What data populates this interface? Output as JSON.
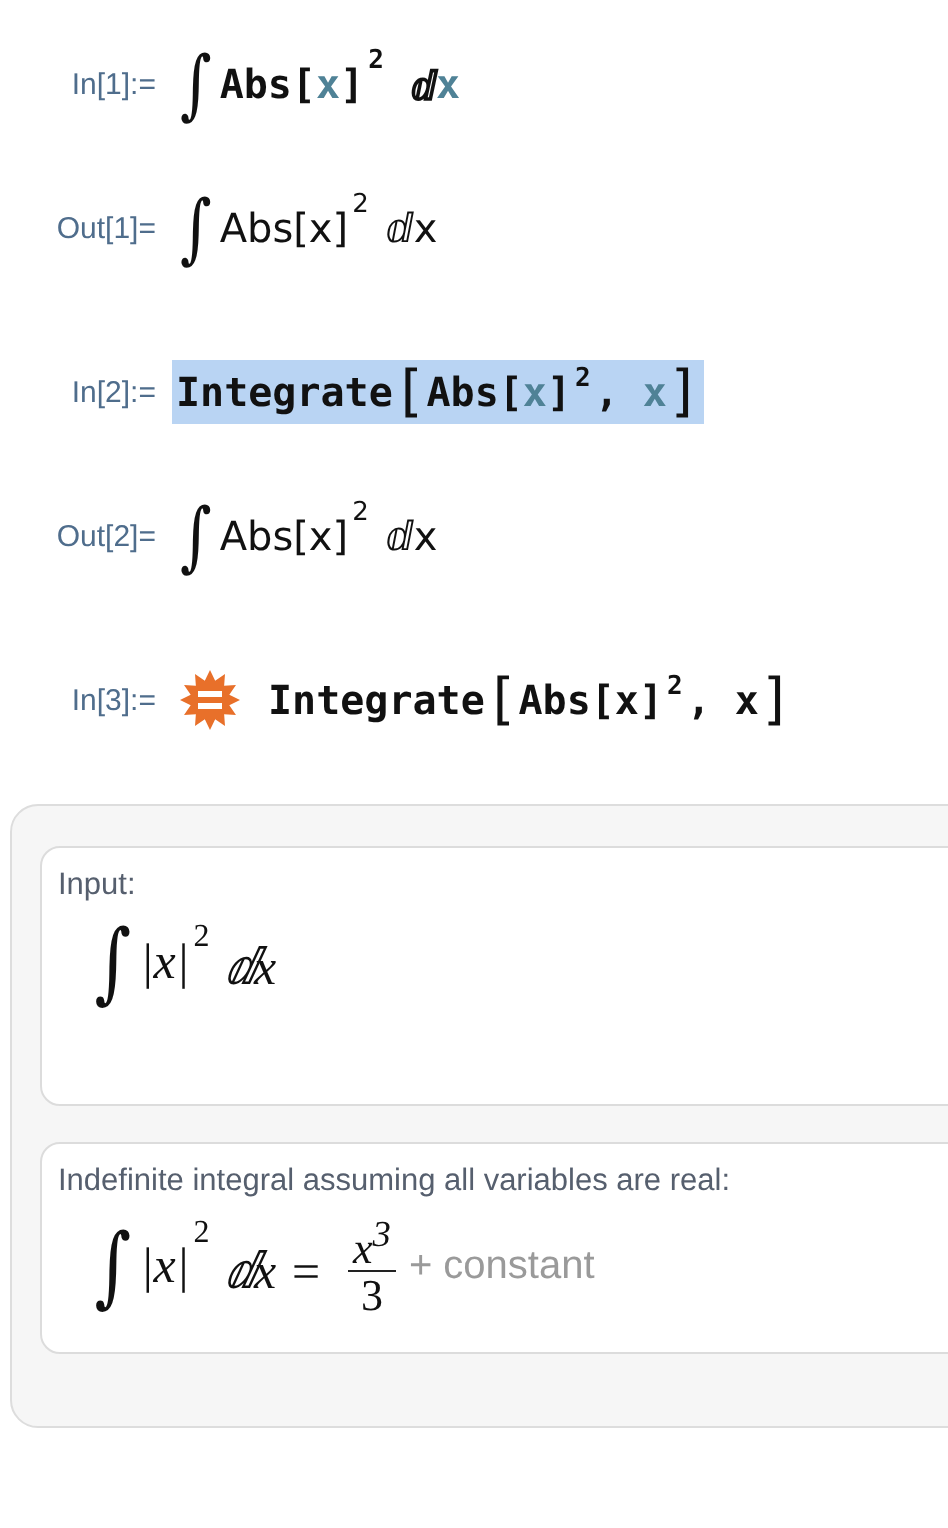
{
  "cells": [
    {
      "label": "In[1]:=",
      "kind": "input",
      "selected": false,
      "tokens": [
        {
          "kind": "integral",
          "text": "∫"
        },
        {
          "kind": "plain",
          "text": "Abs["
        },
        {
          "kind": "var",
          "text": "x"
        },
        {
          "kind": "plain",
          "text": "]"
        },
        {
          "kind": "sup",
          "text": "2"
        },
        {
          "kind": "plain",
          "text": " ⅆ"
        },
        {
          "kind": "var",
          "text": "x"
        }
      ]
    },
    {
      "label": "Out[1]=",
      "kind": "output",
      "selected": false,
      "tokens": [
        {
          "kind": "integral",
          "text": "∫"
        },
        {
          "kind": "plain",
          "text": "Abs[x]"
        },
        {
          "kind": "sup",
          "text": "2"
        },
        {
          "kind": "plain",
          "text": " ⅆx"
        }
      ]
    },
    {
      "label": "In[2]:=",
      "kind": "input",
      "selected": true,
      "tokens": [
        {
          "kind": "plain",
          "text": "Integrate"
        },
        {
          "kind": "bracket",
          "text": "["
        },
        {
          "kind": "plain",
          "text": "Abs["
        },
        {
          "kind": "var",
          "text": "x"
        },
        {
          "kind": "plain",
          "text": "]"
        },
        {
          "kind": "sup",
          "text": "2"
        },
        {
          "kind": "plain",
          "text": ", "
        },
        {
          "kind": "var",
          "text": "x"
        },
        {
          "kind": "bracket",
          "text": "]"
        }
      ]
    },
    {
      "label": "Out[2]=",
      "kind": "output",
      "selected": false,
      "tokens": [
        {
          "kind": "integral",
          "text": "∫"
        },
        {
          "kind": "plain",
          "text": "Abs[x]"
        },
        {
          "kind": "sup",
          "text": "2"
        },
        {
          "kind": "plain",
          "text": " ⅆx"
        }
      ]
    },
    {
      "label": "In[3]:=",
      "kind": "wolfram",
      "selected": false,
      "tokens": [
        {
          "kind": "plain",
          "text": "Integrate"
        },
        {
          "kind": "bracket",
          "text": "["
        },
        {
          "kind": "plain",
          "text": "Abs[x]"
        },
        {
          "kind": "sup",
          "text": "2"
        },
        {
          "kind": "plain",
          "text": ", x"
        },
        {
          "kind": "bracket",
          "text": "]"
        }
      ]
    }
  ],
  "pods": [
    {
      "title": "Input:",
      "tokens": [
        {
          "kind": "integral",
          "text": "∫"
        },
        {
          "kind": "plain",
          "text": "|x|"
        },
        {
          "kind": "sup",
          "text": "2"
        },
        {
          "kind": "plain",
          "text": " ⅆx"
        }
      ]
    },
    {
      "title": "Indefinite integral assuming all variables are real:",
      "tokens": [
        {
          "kind": "integral",
          "text": "∫"
        },
        {
          "kind": "plain",
          "text": "|x|"
        },
        {
          "kind": "sup",
          "text": "2"
        },
        {
          "kind": "plain",
          "text": " ⅆx = "
        },
        {
          "kind": "frac",
          "num": "x$^{3}$",
          "den": "3"
        },
        {
          "kind": "note",
          "text": " + constant"
        }
      ]
    }
  ]
}
